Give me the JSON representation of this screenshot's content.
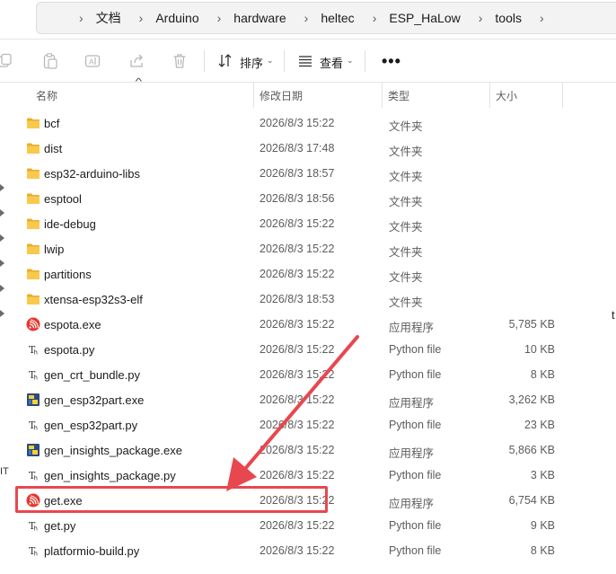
{
  "address_bar": {
    "breadcrumbs": [
      "文档",
      "Arduino",
      "hardware",
      "heltec",
      "ESP_HaLow",
      "tools"
    ]
  },
  "toolbar": {
    "sort_label": "排序",
    "view_label": "查看",
    "more_label": "•••"
  },
  "columns": {
    "name": "名称",
    "date": "修改日期",
    "type": "类型",
    "size": "大小"
  },
  "files": [
    {
      "name": "bcf",
      "date": "2026/8/3 15:22",
      "type": "文件夹",
      "size": "",
      "icon": "folder-icon"
    },
    {
      "name": "dist",
      "date": "2026/8/3 17:48",
      "type": "文件夹",
      "size": "",
      "icon": "folder-icon"
    },
    {
      "name": "esp32-arduino-libs",
      "date": "2026/8/3 18:57",
      "type": "文件夹",
      "size": "",
      "icon": "folder-icon"
    },
    {
      "name": "esptool",
      "date": "2026/8/3 18:56",
      "type": "文件夹",
      "size": "",
      "icon": "folder-icon"
    },
    {
      "name": "ide-debug",
      "date": "2026/8/3 15:22",
      "type": "文件夹",
      "size": "",
      "icon": "folder-icon"
    },
    {
      "name": "lwip",
      "date": "2026/8/3 15:22",
      "type": "文件夹",
      "size": "",
      "icon": "folder-icon"
    },
    {
      "name": "partitions",
      "date": "2026/8/3 15:22",
      "type": "文件夹",
      "size": "",
      "icon": "folder-icon"
    },
    {
      "name": "xtensa-esp32s3-elf",
      "date": "2026/8/3 18:53",
      "type": "文件夹",
      "size": "",
      "icon": "folder-icon"
    },
    {
      "name": "espota.exe",
      "date": "2026/8/3 15:22",
      "type": "应用程序",
      "size": "5,785 KB",
      "icon": "espressif-exe-icon"
    },
    {
      "name": "espota.py",
      "date": "2026/8/3 15:22",
      "type": "Python file",
      "size": "10 KB",
      "icon": "python-file-icon"
    },
    {
      "name": "gen_crt_bundle.py",
      "date": "2026/8/3 15:22",
      "type": "Python file",
      "size": "8 KB",
      "icon": "python-file-icon"
    },
    {
      "name": "gen_esp32part.exe",
      "date": "2026/8/3 15:22",
      "type": "应用程序",
      "size": "3,262 KB",
      "icon": "python-exe-icon"
    },
    {
      "name": "gen_esp32part.py",
      "date": "2026/8/3 15:22",
      "type": "Python file",
      "size": "23 KB",
      "icon": "python-file-icon"
    },
    {
      "name": "gen_insights_package.exe",
      "date": "2026/8/3 15:22",
      "type": "应用程序",
      "size": "5,866 KB",
      "icon": "python-exe-icon"
    },
    {
      "name": "gen_insights_package.py",
      "date": "2026/8/3 15:22",
      "type": "Python file",
      "size": "3 KB",
      "icon": "python-file-icon"
    },
    {
      "name": "get.exe",
      "date": "2026/8/3 15:22",
      "type": "应用程序",
      "size": "6,754 KB",
      "icon": "espressif-exe-icon"
    },
    {
      "name": "get.py",
      "date": "2026/8/3 15:22",
      "type": "Python file",
      "size": "9 KB",
      "icon": "python-file-icon"
    },
    {
      "name": "platformio-build.py",
      "date": "2026/8/3 15:22",
      "type": "Python file",
      "size": "8 KB",
      "icon": "python-file-icon"
    }
  ],
  "left_edge_text": "IT",
  "right_edge_text": "t",
  "colors": {
    "folder": "#f4c542",
    "espressif": "#e7352c",
    "annotation": "#e8474f",
    "header_text": "#5b5b5b",
    "meta_text": "#5c5c5c"
  }
}
